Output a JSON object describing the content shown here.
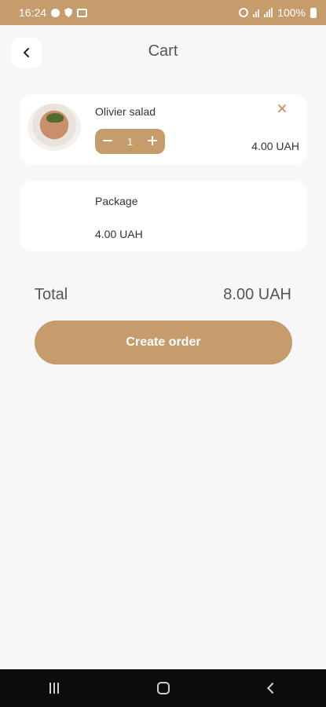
{
  "status_bar": {
    "time": "16:24",
    "battery_text": "100%"
  },
  "header": {
    "title": "Cart"
  },
  "cart_items": [
    {
      "name": "Olivier salad",
      "quantity": "1",
      "price": "4.00 UAH",
      "thumbnail": "olivier-salad-photo"
    }
  ],
  "package": {
    "name": "Package",
    "price": "4.00 UAH"
  },
  "total": {
    "label": "Total",
    "value": "8.00 UAH"
  },
  "actions": {
    "create_order": "Create order"
  },
  "icons": {
    "back": "chevron-left-icon",
    "remove": "close-icon",
    "minus": "minus-icon",
    "plus": "plus-icon"
  },
  "colors": {
    "accent": "#c69c6d",
    "background": "#f7f7f7",
    "card": "#ffffff"
  }
}
